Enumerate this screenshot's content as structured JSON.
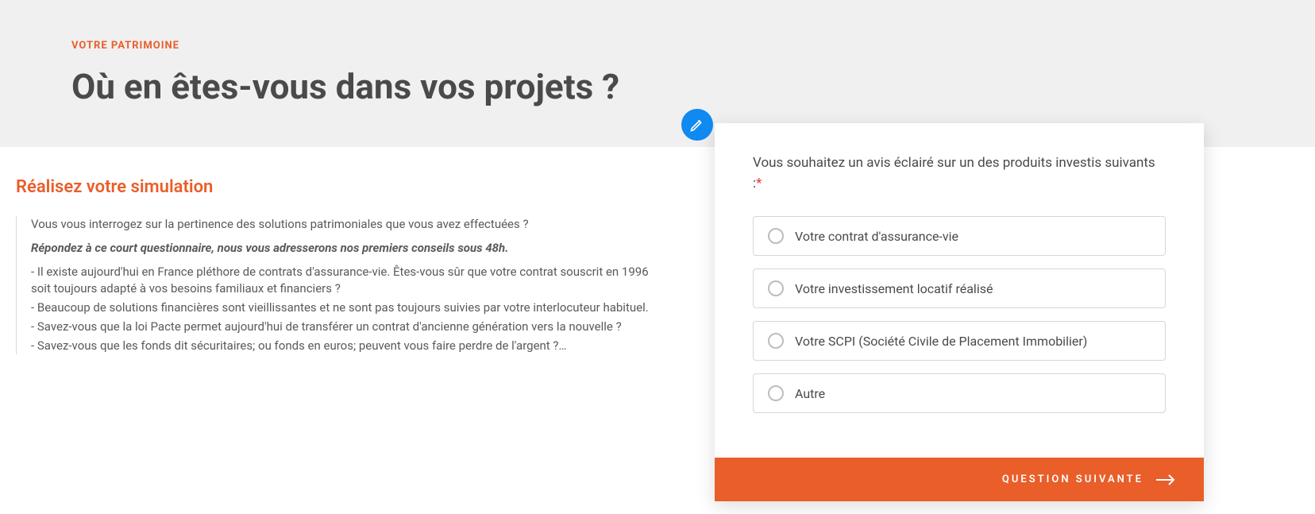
{
  "header": {
    "eyebrow": "VOTRE PATRIMOINE",
    "title": "Où en êtes-vous dans vos projets ?"
  },
  "simulation": {
    "heading": "Réalisez votre simulation",
    "intro_q": "Vous vous interrogez sur la pertinence des solutions patrimoniales que vous avez effectuées ?",
    "bold_line": "Répondez à ce court questionnaire, nous vous adresserons nos premiers conseils sous 48h.",
    "bullets": [
      "- Il existe aujourd'hui en France pléthore de contrats d'assurance-vie. Êtes-vous sûr que votre contrat souscrit en 1996 soit toujours adapté à vos besoins familiaux et financiers ?",
      "- Beaucoup de solutions financières sont vieillissantes et ne sont pas toujours suivies par votre interlocuteur habituel.",
      "- Savez-vous que la loi Pacte permet aujourd'hui de transférer un contrat d'ancienne génération vers la nouvelle ?",
      "- Savez-vous que les fonds dit sécuritaires; ou fonds en euros; peuvent vous faire perdre de l'argent ?…"
    ]
  },
  "form": {
    "question": "Vous souhaitez un avis éclairé sur un des produits investis suivants :",
    "required_mark": "*",
    "options": [
      "Votre contrat d'assurance-vie",
      "Votre investissement locatif réalisé",
      "Votre SCPI (Société Civile de Placement Immobilier)",
      "Autre"
    ],
    "next_label": "QUESTION SUIVANTE"
  }
}
